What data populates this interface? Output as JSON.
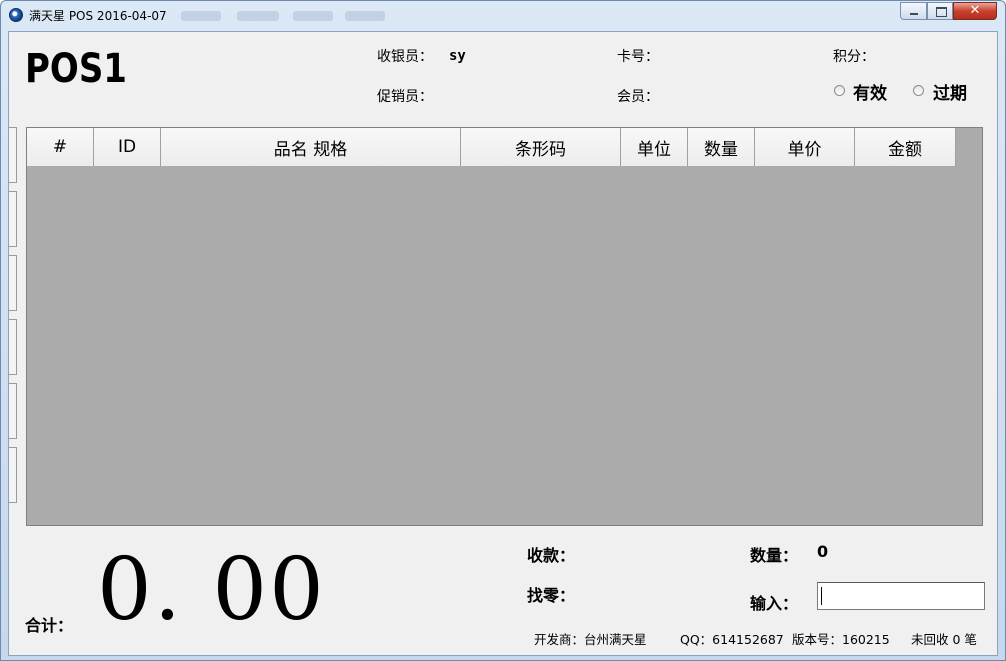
{
  "window": {
    "title": "满天星 POS 2016-04-07",
    "close_glyph": "✕"
  },
  "header": {
    "pos_name": "POS1",
    "cashier_label": "收银员：",
    "cashier_value": "sy",
    "promoter_label": "促销员：",
    "card_label": "卡号：",
    "member_label": "会员：",
    "points_label": "积分：",
    "radio_valid": "有效",
    "radio_expired": "过期"
  },
  "grid": {
    "columns": [
      "#",
      "ID",
      "品名 规格",
      "条形码",
      "单位",
      "数量",
      "单价",
      "金额"
    ],
    "rows": []
  },
  "footer": {
    "total_label": "合计：",
    "total_value": "0. 00",
    "received_label": "收款：",
    "change_label": "找零：",
    "qty_label": "数量：",
    "qty_value": "0",
    "input_label": "输入：",
    "input_value": ""
  },
  "status": {
    "developer": "开发商：台州满天星",
    "qq": "QQ：614152687",
    "version": "版本号：160215",
    "unrecovered": "未回收 0 笔"
  }
}
